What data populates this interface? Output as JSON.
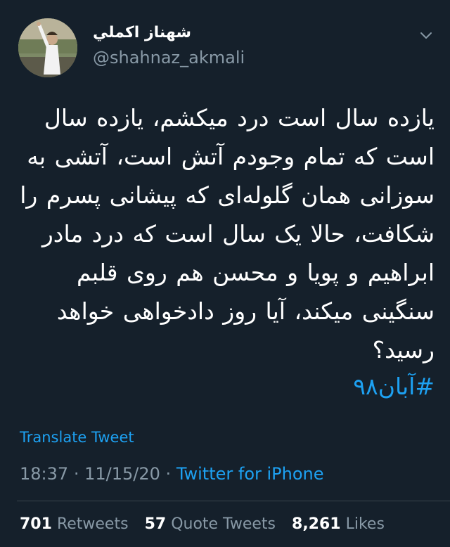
{
  "user": {
    "display_name": "شهناز اکملي",
    "handle": "@shahnaz_akmali"
  },
  "tweet": {
    "text": "یازده سال است درد میکشم، یازده سال است که تمام وجودم آتش است، آتشی به سوزانی همان گلوله‌ای که پیشانی پسرم را شکافت، حالا یک سال است که درد مادر ابراهیم و پویا و محسن هم روی قلبم سنگینی میکند، آیا روز دادخواهی خواهد رسید؟",
    "hashtag": "#آبان۹۸",
    "translate_label": "Translate Tweet",
    "time": "18:37",
    "date": "11/15/20",
    "separator": "·",
    "source": "Twitter for iPhone"
  },
  "stats": {
    "retweets_count": "701",
    "retweets_label": "Retweets",
    "quotes_count": "57",
    "quotes_label": "Quote Tweets",
    "likes_count": "8,261",
    "likes_label": "Likes"
  },
  "colors": {
    "background": "#15202b",
    "accent": "#1da1f2",
    "secondary_text": "#8899a6",
    "divider": "#38444d"
  },
  "icons": {
    "menu": "chevron-down-icon"
  }
}
